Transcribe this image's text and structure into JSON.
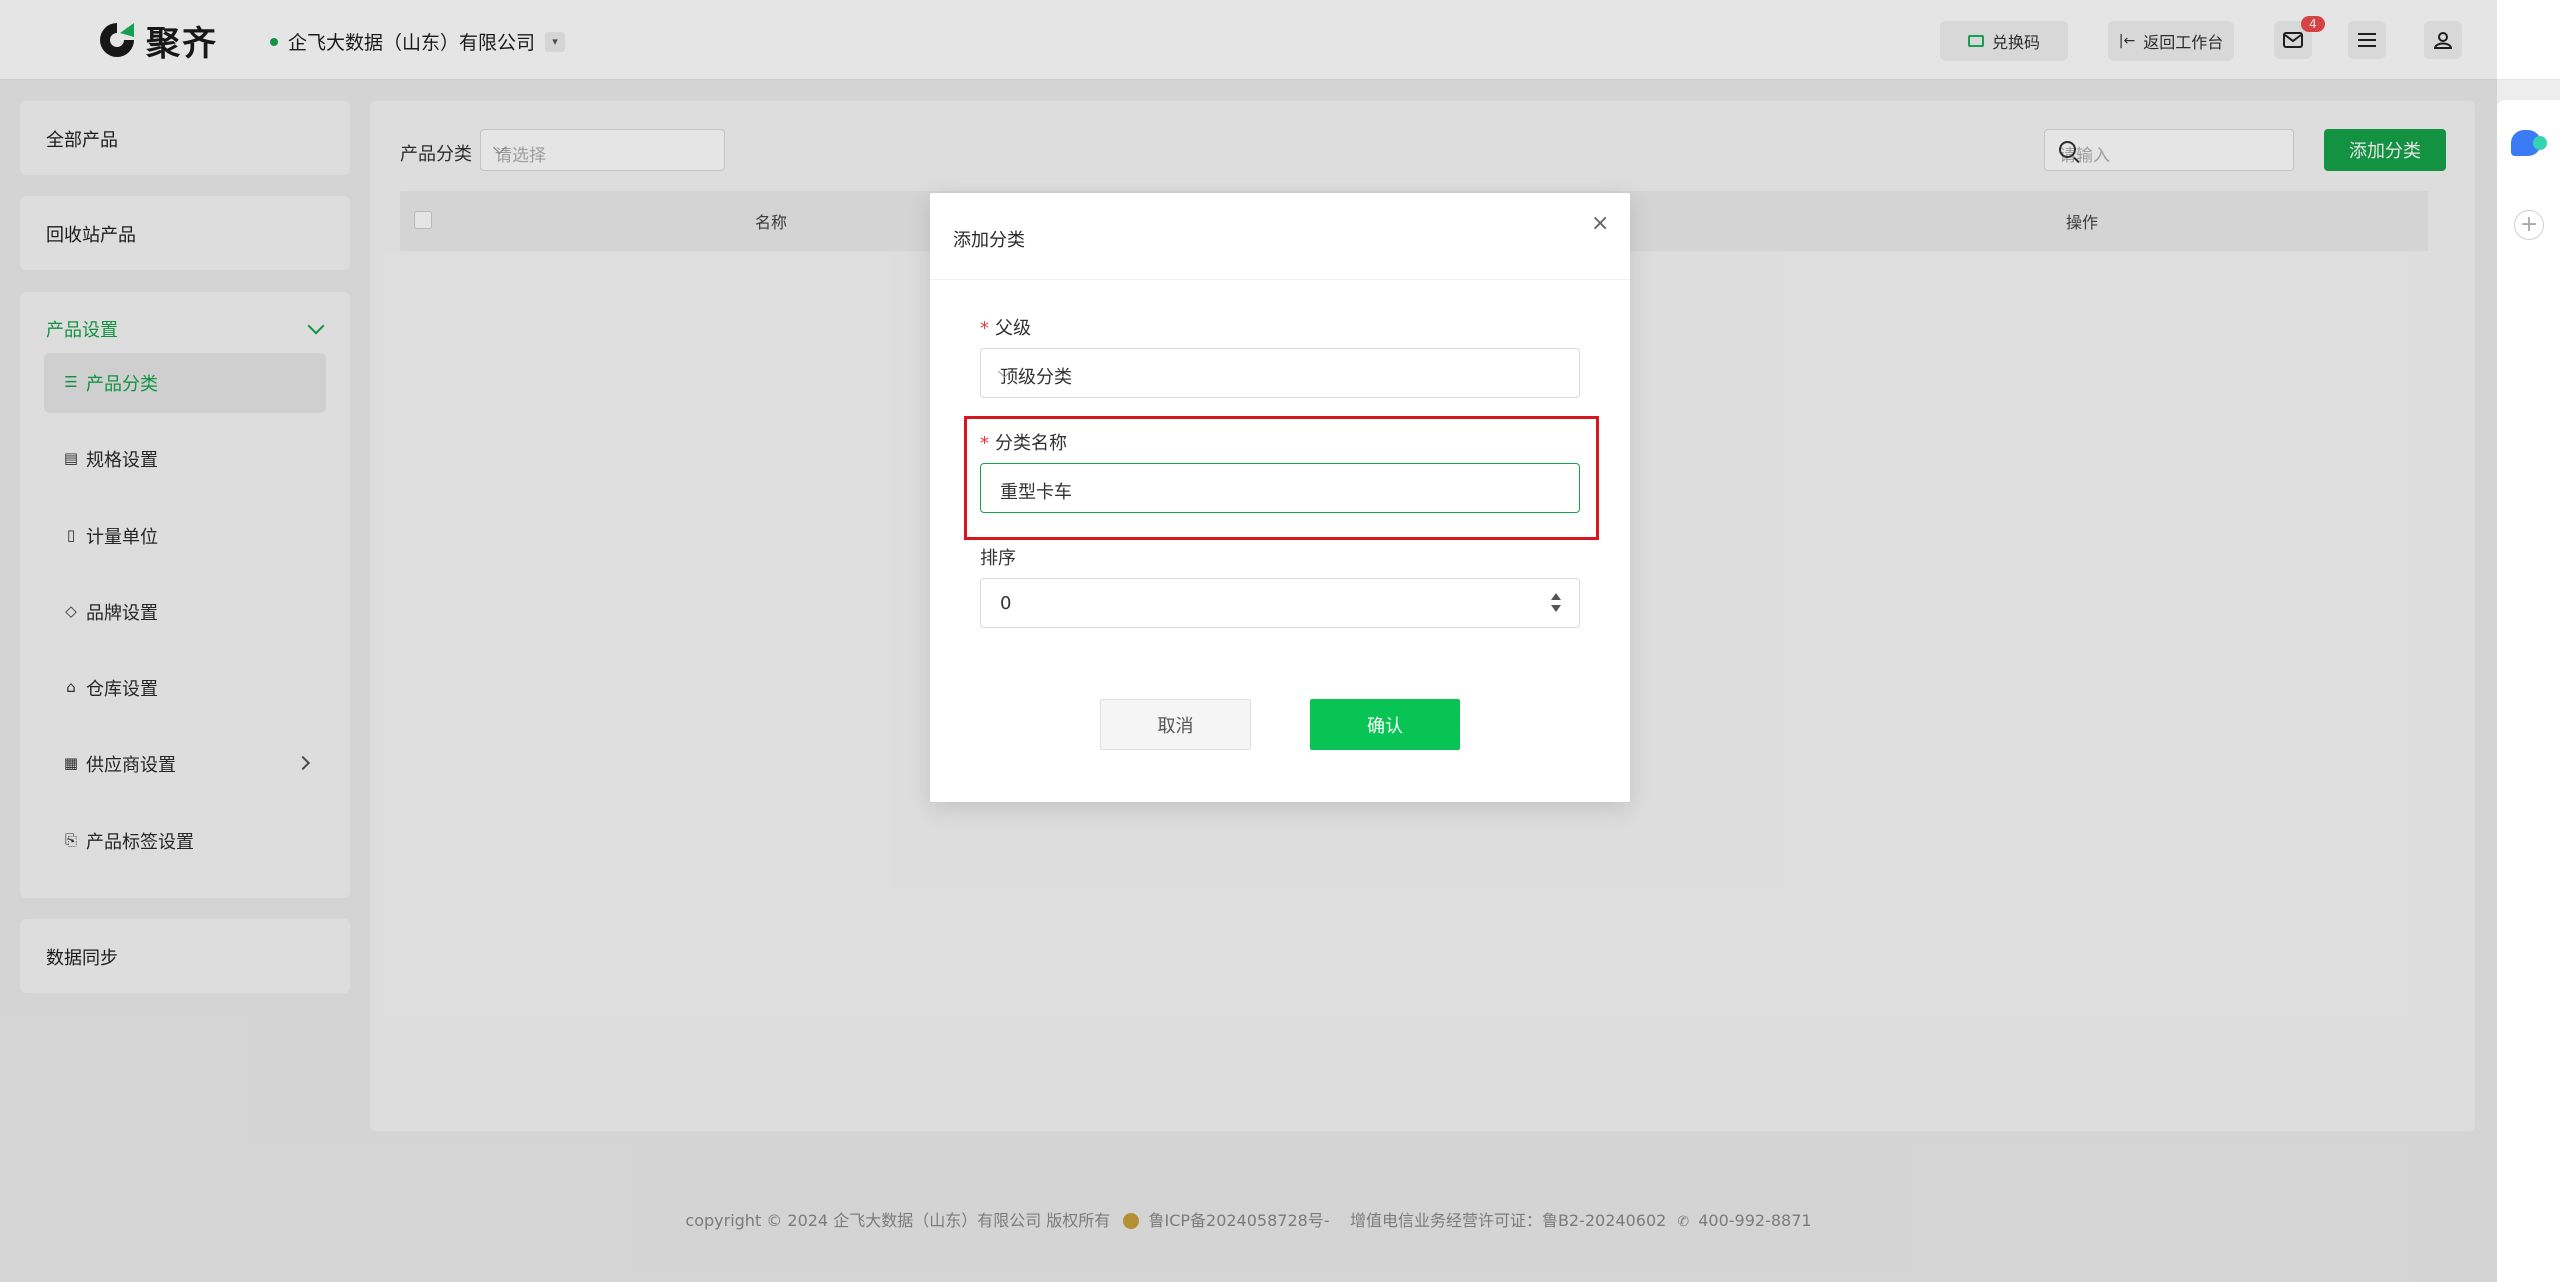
{
  "header": {
    "logo_text": "聚齐",
    "company_name": "企飞大数据（山东）有限公司",
    "redeem_label": "兑换码",
    "back_label": "返回工作台",
    "mail_badge": "4"
  },
  "sidebar": {
    "all_products": "全部产品",
    "recycle_products": "回收站产品",
    "settings_title": "产品设置",
    "items": [
      {
        "label": "产品分类",
        "icon": "list-icon",
        "active": true
      },
      {
        "label": "规格设置",
        "icon": "spec-icon"
      },
      {
        "label": "计量单位",
        "icon": "unit-icon"
      },
      {
        "label": "品牌设置",
        "icon": "tag-icon"
      },
      {
        "label": "仓库设置",
        "icon": "warehouse-icon"
      },
      {
        "label": "供应商设置",
        "icon": "supplier-icon",
        "has_arrow": true
      },
      {
        "label": "产品标签设置",
        "icon": "bookmark-icon"
      }
    ],
    "data_sync": "数据同步"
  },
  "main": {
    "filter_label": "产品分类",
    "filter_placeholder": "请选择",
    "search_placeholder": "请输入",
    "add_button": "添加分类",
    "columns": {
      "name": "名称",
      "actions": "操作"
    }
  },
  "dialog": {
    "title": "添加分类",
    "parent_label": "父级",
    "parent_value": "顶级分类",
    "name_label": "分类名称",
    "name_value": "重型卡车",
    "sort_label": "排序",
    "sort_value": "0",
    "cancel": "取消",
    "confirm": "确认"
  },
  "footer": {
    "copyright": "copyright © 2024 企飞大数据（山东）有限公司 版权所有",
    "icp": "鲁ICP备2024058728号-",
    "license": "增值电信业务经营许可证：鲁B2-20240602",
    "phone": "400-992-8871"
  },
  "colors": {
    "accent": "#16a34a",
    "confirm_button": "#08c454",
    "required": "#e53935",
    "highlight_box": "#d6171f"
  }
}
